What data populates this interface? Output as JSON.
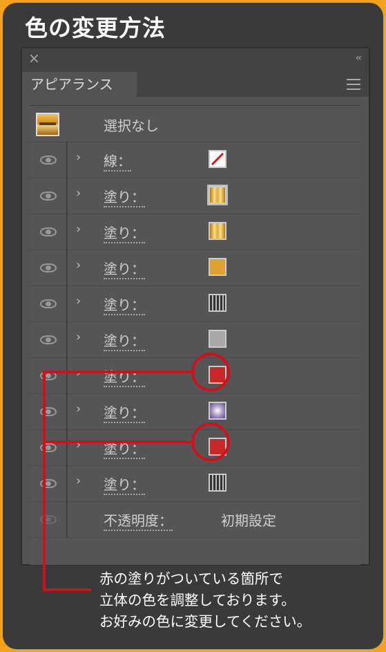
{
  "header": {
    "title": "色の変更方法"
  },
  "panel": {
    "close_glyph": "×",
    "collapse_glyph": "‹‹",
    "tab_label": "アピアランス",
    "selection_label": "選択なし",
    "rows": [
      {
        "label": "線：",
        "swatch": "stroke-none"
      },
      {
        "label": "塗り：",
        "swatch": "gold-gradient-framed"
      },
      {
        "label": "塗り：",
        "swatch": "gold-gradient"
      },
      {
        "label": "塗り：",
        "swatch": "orange",
        "color": "#e0a032"
      },
      {
        "label": "塗り：",
        "swatch": "stripes"
      },
      {
        "label": "塗り：",
        "swatch": "gray",
        "color": "#a8a8a8"
      },
      {
        "label": "塗り：",
        "swatch": "red",
        "color": "#c82828"
      },
      {
        "label": "塗り：",
        "swatch": "radial-purple"
      },
      {
        "label": "塗り：",
        "swatch": "red",
        "color": "#c82828"
      },
      {
        "label": "塗り：",
        "swatch": "stripes"
      }
    ],
    "opacity_label": "不透明度：",
    "opacity_value": "初期設定"
  },
  "annotation": {
    "caption_lines": [
      "赤の塗りがついている箇所で",
      "立体の色を調整しております。",
      "お好みの色に変更してください。"
    ],
    "highlight_color": "#d0101a"
  }
}
